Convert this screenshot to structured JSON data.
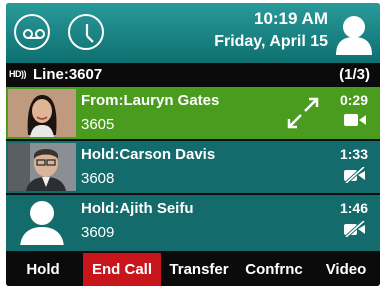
{
  "header": {
    "time": "10:19 AM",
    "date": "Friday, April 15"
  },
  "line": {
    "hd_badge": "HD))",
    "label": "Line:3607",
    "count": "(1/3)"
  },
  "calls": [
    {
      "name": "From:Lauryn Gates",
      "number": "3605",
      "duration": "0:29",
      "state": "active",
      "icon": "video-camera-icon"
    },
    {
      "name": "Hold:Carson Davis",
      "number": "3608",
      "duration": "1:33",
      "state": "hold",
      "icon": "video-off-icon"
    },
    {
      "name": "Hold:Ajith Seifu",
      "number": "3609",
      "duration": "1:46",
      "state": "hold",
      "icon": "video-off-icon"
    }
  ],
  "softkeys": [
    {
      "label": "Hold"
    },
    {
      "label": "End Call"
    },
    {
      "label": "Transfer"
    },
    {
      "label": "Confrnc"
    },
    {
      "label": "Video"
    }
  ],
  "colors": {
    "header_bg": "#1a8a8b",
    "active_call": "#4a9c1e",
    "held_call": "#136b6c",
    "end_call": "#c8141b"
  }
}
